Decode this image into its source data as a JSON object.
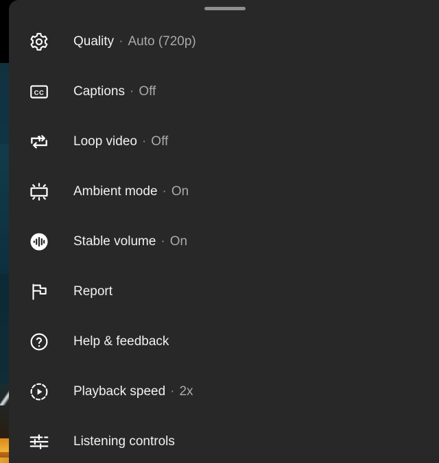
{
  "panel": {
    "background_color": "#282828",
    "label_color": "#f1f1f1",
    "value_color": "#aaaaaa",
    "handle_color": "#8f8f8f",
    "drag_handle_name": "drag-handle"
  },
  "menu": {
    "items": [
      {
        "icon": "gear-icon",
        "label": "Quality",
        "separator": "·",
        "value": "Auto (720p)"
      },
      {
        "icon": "closed-captions-icon",
        "label": "Captions",
        "separator": "·",
        "value": "Off"
      },
      {
        "icon": "loop-one-icon",
        "label": "Loop video",
        "separator": "·",
        "value": "Off"
      },
      {
        "icon": "ambient-mode-icon",
        "label": "Ambient mode",
        "separator": "·",
        "value": "On"
      },
      {
        "icon": "stable-volume-icon",
        "label": "Stable volume",
        "separator": "·",
        "value": "On"
      },
      {
        "icon": "flag-icon",
        "label": "Report",
        "separator": "",
        "value": ""
      },
      {
        "icon": "help-circle-icon",
        "label": "Help & feedback",
        "separator": "",
        "value": ""
      },
      {
        "icon": "playback-speed-icon",
        "label": "Playback speed",
        "separator": "·",
        "value": "2x"
      },
      {
        "icon": "listening-controls-icon",
        "label": "Listening controls",
        "separator": "",
        "value": ""
      }
    ]
  }
}
